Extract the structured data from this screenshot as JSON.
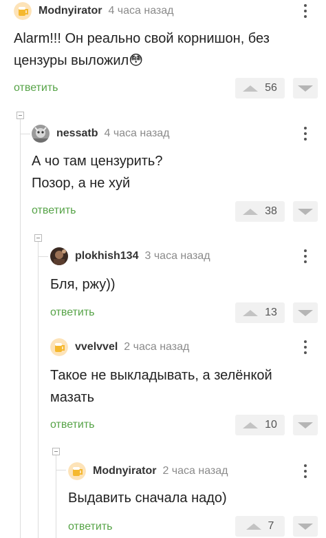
{
  "comments": [
    {
      "author": "Modnyirator",
      "time": "4 часа назад",
      "text": [
        "Alarm!!! Он реально свой корнишон, без",
        "цензуры выложил😳"
      ],
      "reply": "ответить",
      "votes": "56",
      "avatar": "beer-mug"
    },
    {
      "author": "nessatb",
      "time": "4 часа назад",
      "text": [
        "А чо там цензурить?",
        "Позор, а не хуй"
      ],
      "reply": "ответить",
      "votes": "38",
      "avatar": "photo"
    },
    {
      "author": "plokhish134",
      "time": "3 часа назад",
      "text": [
        "Бля, ржу))"
      ],
      "reply": "ответить",
      "votes": "13",
      "avatar": "photo-dark"
    },
    {
      "author": "vvelvvel",
      "time": "2 часа назад",
      "text": [
        "Такое не выкладывать, а зелёнкой",
        "мазать"
      ],
      "reply": "ответить",
      "votes": "10",
      "avatar": "beer-mug"
    },
    {
      "author": "Modnyirator",
      "time": "2 часа назад",
      "text": [
        "Выдавить сначала надо)"
      ],
      "reply": "ответить",
      "votes": "7",
      "avatar": "beer-mug"
    }
  ],
  "icons": {
    "upvote": "triangle-up-icon",
    "downvote": "triangle-down-icon",
    "menu": "more-vertical-icon",
    "collapse": "minus-square-icon"
  },
  "colors": {
    "reply": "#56a347",
    "vote_bg": "#f1f1f1",
    "time": "#8a8a8a"
  }
}
